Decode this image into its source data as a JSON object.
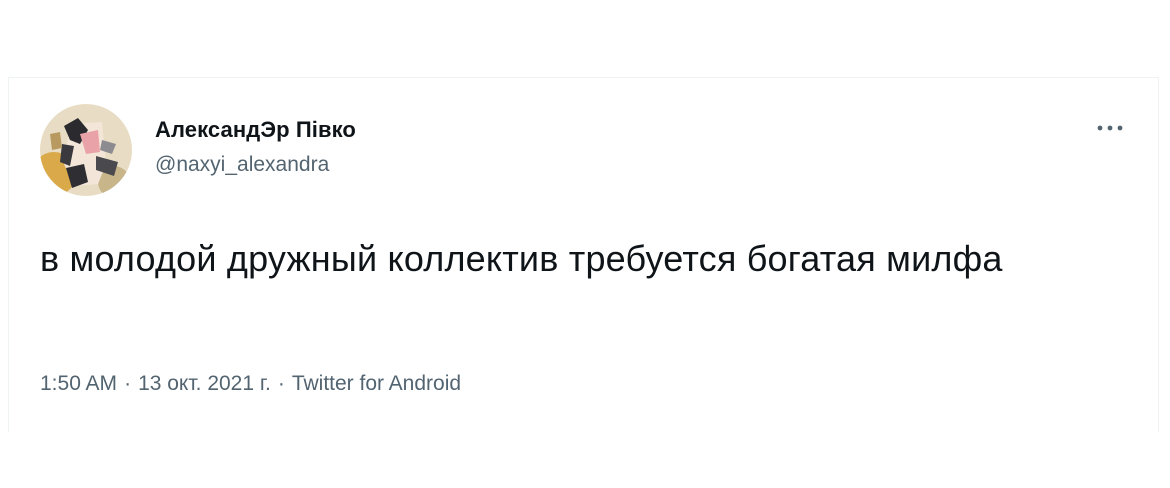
{
  "tweet": {
    "author": {
      "display_name": "АлександЭр Півко",
      "handle": "@naxyi_alexandra",
      "avatar_icon": "user-avatar"
    },
    "more_icon": "more-dots-icon",
    "text": "в молодой дружный коллектив требуется богатая милфа",
    "meta": {
      "time": "1:50 AM",
      "separator": "·",
      "date": "13 окт. 2021 г.",
      "source": "Twitter for Android"
    }
  },
  "colors": {
    "text_primary": "#0f1419",
    "text_secondary": "#536471",
    "border": "#eff3f4"
  }
}
